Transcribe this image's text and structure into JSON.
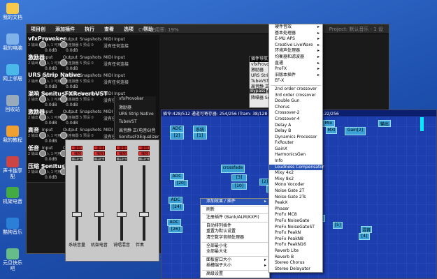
{
  "desktop": {
    "icons": [
      "我的文档",
      "我的电脑",
      "网上邻居",
      "回收站",
      "我的教程",
      "声卡独享配",
      "机架电音",
      "酷狗音乐",
      "元旦快乐吧"
    ]
  },
  "rack": {
    "menu": [
      "项目创",
      "添加插件",
      "执行",
      "查看",
      "选项",
      "帮助"
    ],
    "cpu_label": "CPU 使用率: 19%",
    "project": "Project: 默认音乐 - 1 设",
    "devices": [
      {
        "name": "vfxProvoker",
        "sub": "2 输出 4 输入 1 可用通道连接器 5 预设 0",
        "l1": "Input",
        "l2": "Output",
        "l3": "Snapshots",
        "l4": "MIDI Input",
        "r1": "0.0dB",
        "r2": "0.0dB",
        "r3": "没有任何连接"
      },
      {
        "name": "激励器",
        "sub": "2 输出 4 输入 1 可用通道连接器 5 预设 0",
        "l1": "Input",
        "l2": "Output",
        "l3": "Snapshots",
        "l4": "MIDI Input",
        "r1": "0.0dB",
        "r2": "0.0dB",
        "r3": "没有任何连接"
      },
      {
        "name": "URS Strip Native",
        "sub": "2 输出 4 输入 1 可用通道连接器 5 预设 0",
        "l1": "Input",
        "l2": "Output",
        "l3": "Snapshots",
        "l4": "MIDI Input",
        "r1": "0.0dB",
        "r2": "0.0dB",
        "r3": "没有任何连接"
      },
      {
        "name": "混响 SonitusFXReverbVST",
        "sub": "2 输出 4 输入 1 可用通道连接器 5 预设 0",
        "l1": "Input",
        "l2": "Output",
        "l3": "Snapshots",
        "l4": "MIDI Input",
        "r1": "0.0dB",
        "r2": "0.0dB",
        "r3": "没有任何连接"
      },
      {
        "name": "激励器",
        "sub": "2 输出 4 输入 1 可用通道连接器 5 预设 0",
        "l1": "Input",
        "l2": "Output",
        "l3": "Snapshots",
        "l4": "MIDI Input",
        "r1": "0.0dB",
        "r2": "0.0dB",
        "r3": "没有任何连接"
      },
      {
        "name": "高音",
        "sub": "2 输出 4 输入 1 可用通道连接器 5 预设 0",
        "l1": "Input",
        "l2": "Output",
        "l3": "Snapshots",
        "l4": "MIDI Input",
        "r1": "0.0dB",
        "r2": "0.0dB",
        "r3": "没有任何连接"
      },
      {
        "name": "低音",
        "sub": "2 输出 4 输入 1 可用通道连接器 5 预设 0",
        "l1": "Input",
        "l2": "Output",
        "l3": "Snapshots",
        "l4": "MIDI Input",
        "r1": "0.0dB",
        "r2": "0.0dB",
        "r3": "没有任何连接"
      },
      {
        "name": "压缩 SonitusFXG",
        "sub": "2 输出 4 输入 1 可用通道连接器 5 预设 0",
        "l1": "Input",
        "l2": "Output",
        "l3": "Snapshots",
        "l4": "MIDI Input",
        "r1": "0.0dB",
        "r2": "0.0dB",
        "r3": "没有任何连接"
      }
    ],
    "vpanel": [
      "vfxProvoker",
      "激励器",
      "URS Strip Native",
      "TubeVST",
      "高音静 正(电音6)音",
      "SonitusFXEqualizer",
      "降噪器 SonitusFX"
    ],
    "plugin_list": [
      "插件导航",
      "vfxProvoker",
      "激励器",
      "URS Strip Native",
      "TubeVST",
      "高音静 正(电音6)",
      "SonitusFXEqualizer",
      "降噪器 SonitusFX"
    ],
    "panel_labels": [
      "Bypass",
      "Edit",
      "Reset"
    ]
  },
  "mixer": {
    "cols": [
      {
        "top": "录音",
        "mid": "播放",
        "bot": "开关",
        "name": "系统音量",
        "level": 0.33
      },
      {
        "top": "录音",
        "mid": "播放",
        "bot": "开关",
        "name": "机架电音",
        "level": 0.33
      },
      {
        "top": "录音",
        "mid": "播放",
        "bot": "开关",
        "name": "说唱混音",
        "level": 0.33
      },
      {
        "top": "录音",
        "mid": "播放",
        "bot": "开关",
        "name": "伴奏",
        "level": 0.33
      }
    ]
  },
  "routing": {
    "title": "插令:428/512 通道可寄存器: 254/256 ITram: 38/128 xTram: 0/128 xTram状态: 122/256",
    "boxes": [
      "系统",
      "[1]",
      "ADC",
      "[2]",
      "crossfade",
      "[3]",
      "Mix",
      "Gain[2]",
      "输出",
      "ADC",
      "[20]",
      "ADC",
      "[24]",
      "ADC",
      "[26]",
      "[10]",
      "MXI",
      "[2]",
      "[3]",
      "[0]",
      "[5]",
      "混音",
      "[4]"
    ],
    "ctx1": [
      "添加效果 / 插件",
      "刷新",
      "注册插件 (Bank/ALM/KXPI)",
      "自动排列插件",
      "重置为默认设置",
      "清空数字音频处理器",
      "全部最小化",
      "全部最大化",
      "面板窗口大小",
      "插槽端子大小",
      "高级设置"
    ],
    "ctx2": [
      "硬件音效",
      "基本处理器",
      "E-MU APS",
      "Creative LiveWare",
      "环境声处理器",
      "均衡器和滤波器",
      "直通",
      "ProFX",
      "旧版本插件",
      "EF-X",
      "2nd order crossover",
      "3rd order crossover",
      "Double Gun",
      "Chorus",
      "Crossover-2",
      "Crossover-4",
      "Delay A",
      "Delay B",
      "Dynamics Processor",
      "FxRouter",
      "GainX",
      "HarmonicsGen",
      "Info",
      "Loudness Compensator",
      "Mixy 4x2",
      "Mixy 8x2",
      "Mono Vocoder",
      "Noise Gate 2T",
      "Noise Gate 2Ts",
      "PeakX",
      "Phaser",
      "ProFx MC8",
      "ProFx NoiseGate",
      "ProFx NoiseGateST",
      "ProFx PeakN",
      "ProFx PeakN8",
      "ProFx PeakN16",
      "Reverb Lite",
      "Reverb B",
      "Stereo Chorus",
      "Stereo Delayator"
    ]
  },
  "colors": {
    "accent": "#2a54b8",
    "desktop": "#2b5bb8",
    "routing": "#1d3fae",
    "cyan": "#00eeff"
  }
}
